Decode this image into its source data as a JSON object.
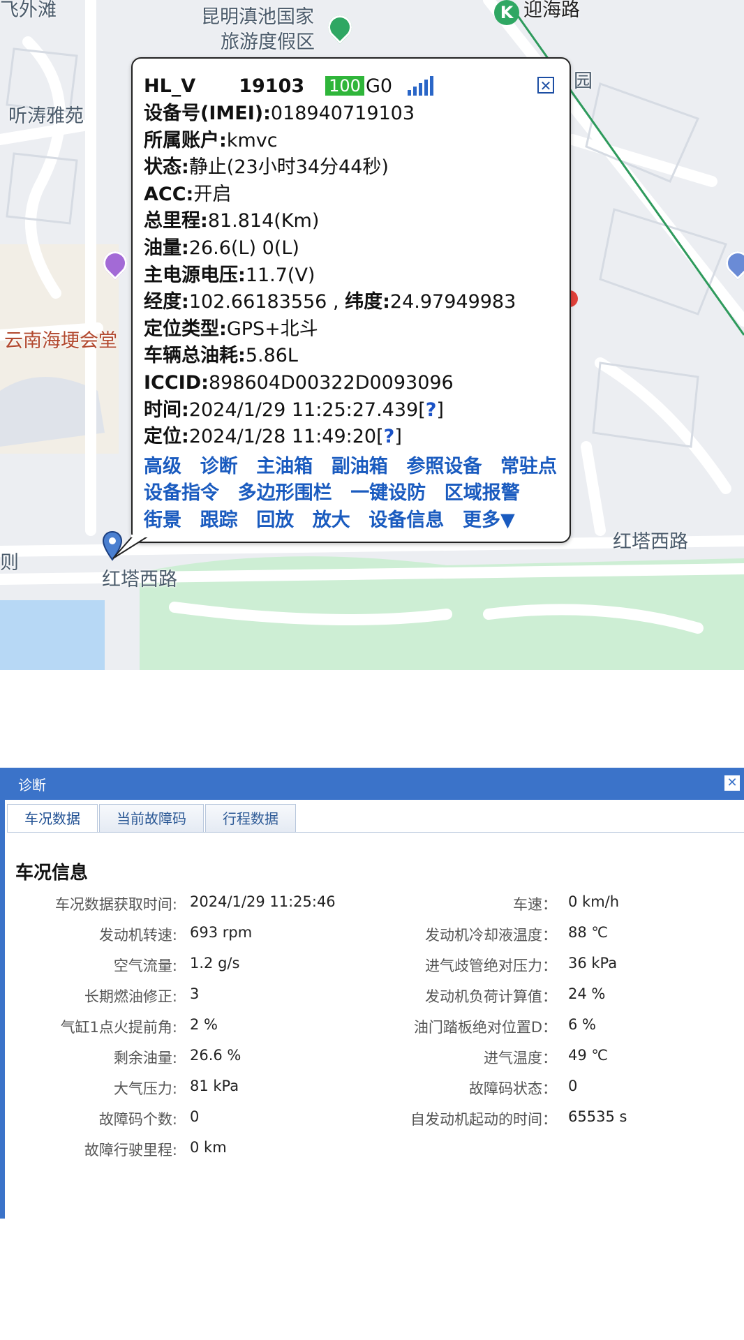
{
  "map": {
    "labels": {
      "top_left": "飞外滩",
      "resort_line1": "昆明滇池国家",
      "resort_line2": "旅游度假区",
      "metro_road": "迎海路",
      "metro_badge": "K",
      "tingtao": "听涛雅苑",
      "hall": "云南海埂会堂",
      "road_right": "红塔西路",
      "road_left": "红塔西路",
      "garden": "园",
      "left_edge": "则"
    },
    "colors": {
      "road": "#ffffff",
      "block": "#e3e6eb",
      "park": "#cdeed4",
      "water": "#b7d8f5",
      "rail": "#2e9a5c"
    }
  },
  "popup": {
    "device_name": "HL_V",
    "device_suffix": "19103",
    "battery": "100",
    "gsm": "G0",
    "close": "✕",
    "lines": [
      {
        "label": "设备号(IMEI):",
        "value": "018940719103"
      },
      {
        "label": "所属账户:",
        "value": "kmvc"
      },
      {
        "label": "状态:",
        "value": "静止(23小时34分44秒)"
      },
      {
        "label": "ACC:",
        "value": "开启"
      },
      {
        "label": "总里程:",
        "value": "81.814(Km)"
      },
      {
        "label": "油量:",
        "value": "26.6(L) 0(L)"
      },
      {
        "label": "主电源电压:",
        "value": "11.7(V)"
      },
      {
        "label": "经度:",
        "value": "102.66183556 , ",
        "label2": "纬度:",
        "value2": "24.97949983"
      },
      {
        "label": "定位类型:",
        "value": "GPS+北斗"
      },
      {
        "label": "车辆总油耗:",
        "value": "5.86L"
      },
      {
        "label": "ICCID:",
        "value": "898604D00322D0093096"
      },
      {
        "label": "时间:",
        "value": "2024/1/29 11:25:27.439[",
        "q": "?",
        "tail": "]"
      },
      {
        "label": "定位:",
        "value": "2024/1/28 11:49:20[",
        "q": "?",
        "tail": "]"
      }
    ],
    "links": [
      [
        "高级",
        "诊断",
        "主油箱",
        "副油箱",
        "参照设备",
        "常驻点"
      ],
      [
        "设备指令",
        "多边形围栏",
        "一键设防",
        "区域报警"
      ],
      [
        "街景",
        "跟踪",
        "回放",
        "放大",
        "设备信息",
        "更多▼"
      ]
    ]
  },
  "diag": {
    "title": "诊断",
    "close": "✕",
    "tabs": [
      "车况数据",
      "当前故障码",
      "行程数据"
    ],
    "section_title": "车况信息",
    "rows": [
      {
        "k1": "车况数据获取时间:",
        "v1": "2024/1/29 11:25:46",
        "k2": "车速：",
        "v2": "0 km/h"
      },
      {
        "k1": "发动机转速:",
        "v1": "693 rpm",
        "k2": "发动机冷却液温度：",
        "v2": "88 ℃"
      },
      {
        "k1": "空气流量:",
        "v1": "1.2 g/s",
        "k2": "进气歧管绝对压力：",
        "v2": "36 kPa"
      },
      {
        "k1": "长期燃油修正:",
        "v1": "3",
        "k2": "发动机负荷计算值：",
        "v2": "24 %"
      },
      {
        "k1": "气缸1点火提前角:",
        "v1": "2 %",
        "k2": "油门踏板绝对位置D：",
        "v2": "6 %"
      },
      {
        "k1": "剩余油量:",
        "v1": "26.6 %",
        "k2": "进气温度：",
        "v2": "49 ℃"
      },
      {
        "k1": "大气压力:",
        "v1": "81 kPa",
        "k2": "故障码状态：",
        "v2": "0"
      },
      {
        "k1": "故障码个数:",
        "v1": "0",
        "k2": "自发动机起动的时间：",
        "v2": "65535 s"
      },
      {
        "k1": "故障行驶里程:",
        "v1": "0 km",
        "k2": "",
        "v2": ""
      }
    ]
  }
}
